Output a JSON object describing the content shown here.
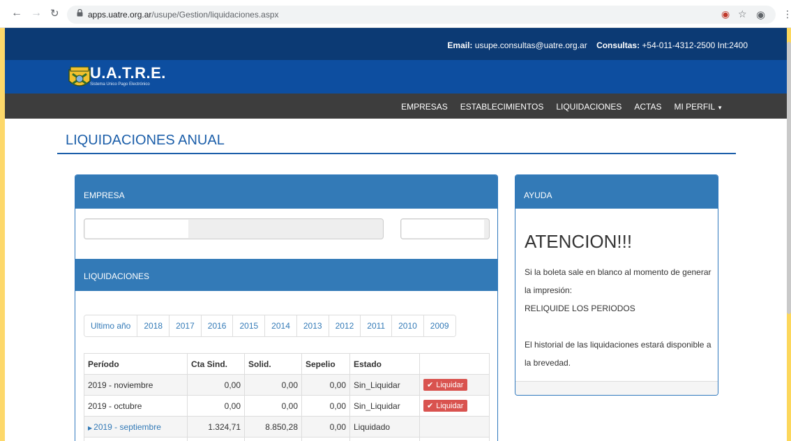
{
  "browser": {
    "url_host": "apps.uatre.org.ar",
    "url_path": "/usupe/Gestion/liquidaciones.aspx"
  },
  "contact": {
    "email_label": "Email:",
    "email": "usupe.consultas@uatre.org.ar",
    "consultas_label": "Consultas:",
    "consultas": "+54-011-4312-2500 Int:2400"
  },
  "brand": {
    "name": "U.A.T.R.E.",
    "subtitle": "Sistema Unico Pago Electrónico",
    "emblem_text": "UATRE"
  },
  "nav": {
    "items": [
      "EMPRESAS",
      "ESTABLECIMIENTOS",
      "LIQUIDACIONES",
      "ACTAS",
      "MI PERFIL"
    ]
  },
  "page_title": "LIQUIDACIONES ANUAL",
  "empresa": {
    "header": "EMPRESA"
  },
  "liquidaciones": {
    "header": "LIQUIDACIONES",
    "years": [
      "Ultimo año",
      "2018",
      "2017",
      "2016",
      "2015",
      "2014",
      "2013",
      "2012",
      "2011",
      "2010",
      "2009"
    ],
    "columns": [
      "Período",
      "Cta Sind.",
      "Solid.",
      "Sepelio",
      "Estado",
      ""
    ],
    "button_label": "Liquidar",
    "rows": [
      {
        "periodo": "2019 - noviembre",
        "cta": "0,00",
        "solid": "0,00",
        "sepelio": "0,00",
        "estado": "Sin_Liquidar"
      },
      {
        "periodo": "2019 - octubre",
        "cta": "0,00",
        "solid": "0,00",
        "sepelio": "0,00",
        "estado": "Sin_Liquidar"
      },
      {
        "periodo": "2019 - septiembre",
        "cta": "1.324,71",
        "solid": "8.850,28",
        "sepelio": "0,00",
        "estado": "Liquidado"
      }
    ]
  },
  "ayuda": {
    "header": "AYUDA",
    "title": "ATENCION!!!",
    "line1": "Si la boleta sale en blanco al momento de generar la impresión:",
    "line2": "RELIQUIDE LOS PERIODOS",
    "line3": "El historial de las liquidaciones estará disponible a la brevedad."
  },
  "colors": {
    "topbar": "#0c3a74",
    "brand": "#0d4ea0",
    "navbar": "#3d3d3d",
    "accent": "#337ab7",
    "danger": "#d9534f"
  }
}
